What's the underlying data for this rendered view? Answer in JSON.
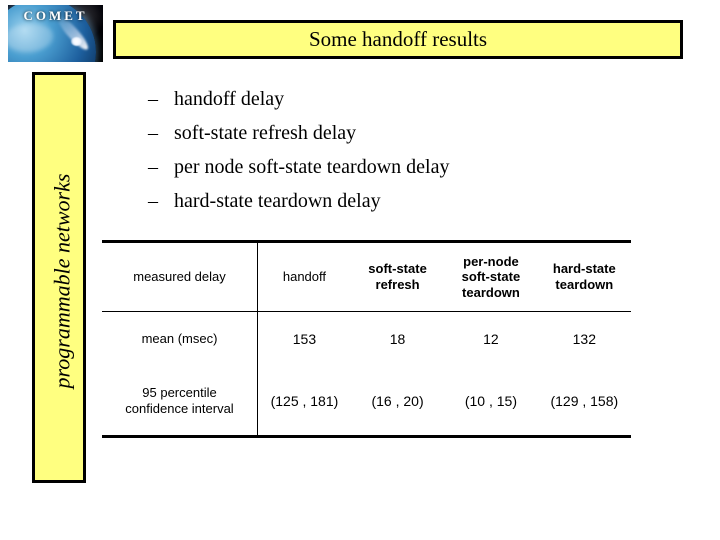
{
  "logo": {
    "wordmark": "COMET",
    "icon_name": "comet-over-earth-logo"
  },
  "header": {
    "title": "Some handoff results"
  },
  "sidebar": {
    "label": "programmable networks"
  },
  "bullets": {
    "marker": "–",
    "items": [
      "handoff delay",
      "soft-state refresh delay",
      "per node soft-state teardown delay",
      "hard-state teardown delay"
    ]
  },
  "table": {
    "corner_header": "measured delay",
    "columns": [
      "handoff",
      "soft-state\nrefresh",
      "per-node\nsoft-state\nteardown",
      "hard-state\nteardown"
    ],
    "columns_display": [
      [
        "handoff"
      ],
      [
        "soft-state",
        "refresh"
      ],
      [
        "per-node",
        "soft-state",
        "teardown"
      ],
      [
        "hard-state",
        "teardown"
      ]
    ],
    "rows": [
      {
        "label": "mean (msec)",
        "label_lines": [
          "mean (msec)"
        ],
        "values": [
          "153",
          "18",
          "12",
          "132"
        ]
      },
      {
        "label": "95 percentile confidence interval",
        "label_lines": [
          "95 percentile",
          "confidence interval"
        ],
        "values": [
          "(125 , 181)",
          "(16 , 20)",
          "(10 , 15)",
          "(129 , 158)"
        ]
      }
    ]
  },
  "colors": {
    "accent_yellow": "#ffff80",
    "border_black": "#000000",
    "page_background": "#ffffff"
  }
}
